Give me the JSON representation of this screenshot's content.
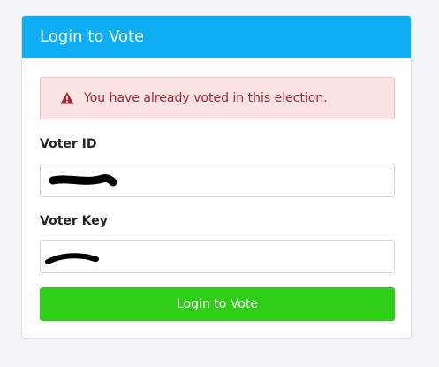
{
  "card": {
    "title": "Login to Vote"
  },
  "alert": {
    "message": "You have already voted in this election.",
    "icon": "warning-triangle-icon"
  },
  "form": {
    "voter_id_label": "Voter ID",
    "voter_key_label": "Voter Key",
    "submit_label": "Login to Vote"
  },
  "colors": {
    "header": "#0eaef4",
    "alert_bg": "#fbe2e3",
    "alert_text": "#a12730",
    "button": "#2ece17"
  }
}
